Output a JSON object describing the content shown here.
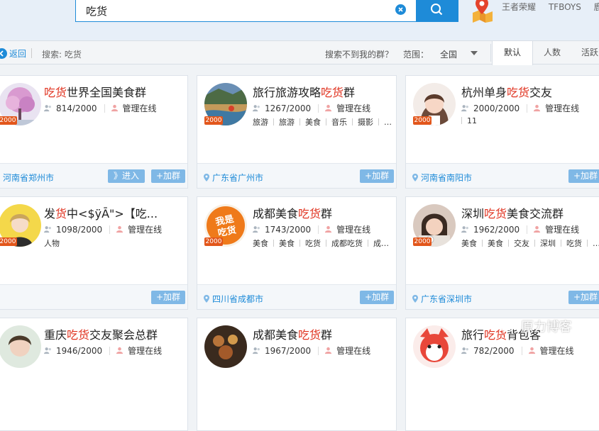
{
  "search": {
    "query": "吃货"
  },
  "hot_words": [
    "王者荣耀",
    "TFBOYS",
    "鹿晗"
  ],
  "toolbar": {
    "back_label": "返回",
    "breadcrumb": "搜索: 吃货",
    "not_found_text": "搜索不到我的群？",
    "range_label": "范围：",
    "range_value": "全国",
    "sort_tabs": [
      "默认",
      "人数",
      "活跃"
    ]
  },
  "cards": [
    {
      "name_hl": "吃货",
      "name_rest": "世界全国美食群",
      "members": "814/2000",
      "status": "管理在线",
      "tags": [],
      "location": "河南省郑州市",
      "enter_label": "》进入",
      "join_label": "+加群",
      "badge": "2000"
    },
    {
      "name_pre": "旅行旅游攻略",
      "name_hl": "吃货",
      "name_rest": "群",
      "members": "1267/2000",
      "status": "管理在线",
      "tags": [
        "旅游",
        "旅游",
        "美食",
        "音乐",
        "摄影",
        "…"
      ],
      "location": "广东省广州市",
      "join_label": "+加群",
      "badge": "2000"
    },
    {
      "name_pre": "杭州单身",
      "name_hl": "吃货",
      "name_rest": "交友",
      "members": "2000/2000",
      "status": "管理在线",
      "tags": [
        "11"
      ],
      "location": "河南省南阳市",
      "join_label": "+加群",
      "badge": "2000"
    },
    {
      "name_pre": "发",
      "name_hl": "货",
      "name_rest": "中<$ÿĀ\">【吃...",
      "members": "1098/2000",
      "status": "管理在线",
      "tags": [
        "人物"
      ],
      "location": "",
      "join_label": "+加群",
      "badge": "2000"
    },
    {
      "name_pre": "成都美食",
      "name_hl": "吃货",
      "name_rest": "群",
      "members": "1743/2000",
      "status": "管理在线",
      "tags": [
        "美食",
        "美食",
        "吃货",
        "成都吃货",
        "成…"
      ],
      "location": "四川省成都市",
      "join_label": "+加群",
      "badge": "2000",
      "avatar_text": "我是吃货"
    },
    {
      "name_pre": "深圳",
      "name_hl": "吃货",
      "name_rest": "美食交流群",
      "members": "1962/2000",
      "status": "管理在线",
      "tags": [
        "美食",
        "美食",
        "交友",
        "深圳",
        "吃货",
        "…"
      ],
      "location": "广东省深圳市",
      "join_label": "+加群",
      "badge": "2000"
    },
    {
      "name_pre": "重庆",
      "name_hl": "吃货",
      "name_rest": "交友聚会总群",
      "members": "1946/2000",
      "status": "管理在线",
      "tags": [],
      "location": "",
      "join_label": "",
      "badge": ""
    },
    {
      "name_pre": "成都美食",
      "name_hl": "吃货",
      "name_rest": "群",
      "members": "1967/2000",
      "status": "管理在线",
      "tags": [],
      "location": "",
      "join_label": "",
      "badge": ""
    },
    {
      "name_pre": "旅行",
      "name_hl": "吃货",
      "name_rest": "背包客",
      "members": "782/2000",
      "status": "管理在线",
      "tags": [],
      "location": "",
      "join_label": "",
      "badge": ""
    }
  ],
  "watermark": "原力博客",
  "colors": {
    "accent": "#1e8bd8",
    "highlight": "#e0321f",
    "badge": "#e2561b",
    "button": "#7fb8e6"
  }
}
